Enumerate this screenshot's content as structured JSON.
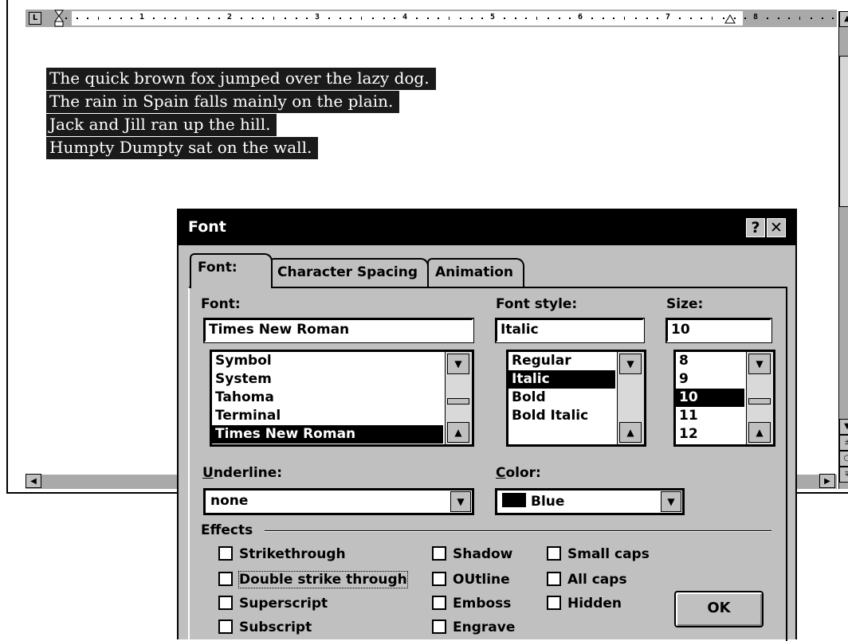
{
  "ruler": {
    "numbers": [
      "1",
      "2",
      "3",
      "4",
      "5",
      "6",
      "7",
      "8"
    ],
    "tab_stop_glyph": "L"
  },
  "document": {
    "lines": [
      "The quick brown fox jumped over the lazy dog.",
      "The rain in Spain falls mainly on the plain.",
      "Jack and Jill ran up the hill.",
      "Humpty Dumpty sat on the wall."
    ],
    "selection_color": "#1a1a1a"
  },
  "dialog": {
    "title": "Font",
    "help_button": "?",
    "close_button": "✕",
    "tabs": [
      "Font:",
      "Character Spacing",
      "Animation"
    ],
    "font": {
      "label": "Font:",
      "value": "Times New Roman",
      "options": [
        "Symbol",
        "System",
        "Tahoma",
        "Terminal",
        "Times New Roman"
      ],
      "selected_index": 4
    },
    "font_style": {
      "label": "Font style:",
      "value": "Italic",
      "options": [
        "Regular",
        "Italic",
        "Bold",
        "Bold Italic"
      ],
      "selected_index": 1
    },
    "size": {
      "label": "Size:",
      "value": "10",
      "options": [
        "8",
        "9",
        "10",
        "11",
        "12"
      ],
      "selected_index": 2
    },
    "underline": {
      "label_u": "U",
      "label_rest": "nderline:",
      "value": "none"
    },
    "color": {
      "label_u": "C",
      "label_rest": "olor:",
      "value": "Blue",
      "swatch": "#000000"
    },
    "effects": {
      "label": "Effects",
      "col1": [
        "Strikethrough",
        "Double strike through",
        "Superscript",
        "Subscript"
      ],
      "col2": [
        "Shadow",
        "OUtline",
        "Emboss",
        "Engrave"
      ],
      "col3": [
        "Small caps",
        "All caps",
        "Hidden"
      ]
    },
    "ok_label": "OK"
  }
}
